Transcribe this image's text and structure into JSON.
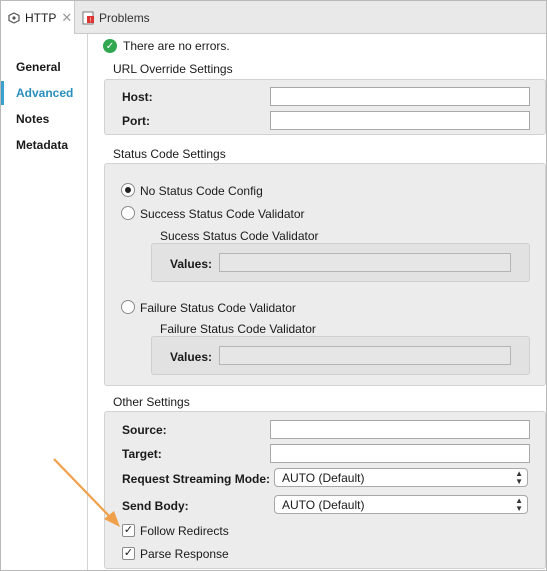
{
  "tabs": [
    {
      "label": "HTTP",
      "icon": "http-connector-icon",
      "active": true
    },
    {
      "label": "Problems",
      "icon": "problems-icon",
      "active": false
    }
  ],
  "sidebar": {
    "items": [
      {
        "label": "General",
        "selected": false
      },
      {
        "label": "Advanced",
        "selected": true
      },
      {
        "label": "Notes",
        "selected": false
      },
      {
        "label": "Metadata",
        "selected": false
      }
    ]
  },
  "status": {
    "text": "There are no errors.",
    "icon": "check-circle-icon"
  },
  "url_override": {
    "title": "URL Override Settings",
    "host_label": "Host:",
    "host_value": "",
    "port_label": "Port:",
    "port_value": ""
  },
  "status_code": {
    "title": "Status Code Settings",
    "option_none": "No Status Code Config",
    "option_success": "Success Status Code Validator",
    "success_group_title": "Sucess Status Code Validator",
    "success_values_label": "Values:",
    "option_failure": "Failure Status Code Validator",
    "failure_group_title": "Failure Status Code Validator",
    "failure_values_label": "Values:",
    "selected": "none"
  },
  "other": {
    "title": "Other Settings",
    "source_label": "Source:",
    "source_value": "",
    "target_label": "Target:",
    "target_value": "",
    "streaming_label": "Request Streaming Mode:",
    "streaming_value": "AUTO (Default)",
    "send_body_label": "Send Body:",
    "send_body_value": "AUTO (Default)",
    "follow_redirects_label": "Follow Redirects",
    "follow_redirects_checked": true,
    "parse_response_label": "Parse Response",
    "parse_response_checked": true
  },
  "annotation": {
    "color": "#f0a04b"
  },
  "colors": {
    "accent": "#2a8fbd",
    "success": "#2fa84f"
  }
}
